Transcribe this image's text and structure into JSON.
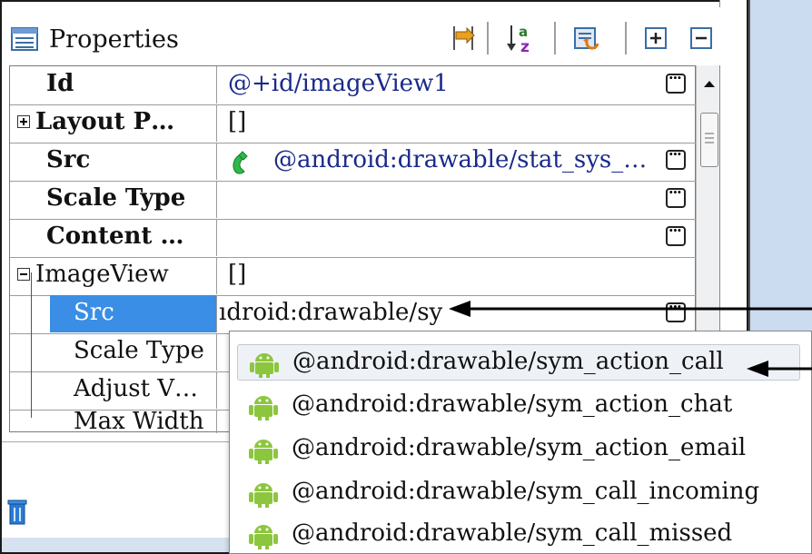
{
  "header": {
    "title": "Properties",
    "toolbar": [
      {
        "name": "show-advanced-icon"
      },
      {
        "name": "sort-alphabetical-icon"
      },
      {
        "name": "restore-default-icon"
      },
      {
        "name": "expand-all-icon"
      },
      {
        "name": "collapse-all-icon"
      }
    ]
  },
  "grid": {
    "rows": [
      {
        "name": "Id",
        "value": "@+id/imageView1"
      },
      {
        "name": "Layout P…",
        "value": "[]"
      },
      {
        "name": "Src",
        "value": "@android:drawable/stat_sys_…"
      },
      {
        "name": "Scale Type",
        "value": ""
      },
      {
        "name": "Content …",
        "value": ""
      },
      {
        "name": "ImageView",
        "value": "[]"
      },
      {
        "name": "Src",
        "value": "ıdroid:drawable/sy"
      },
      {
        "name": "Scale Type",
        "value": ""
      },
      {
        "name": "Adjust V…",
        "value": ""
      },
      {
        "name": "Max Width",
        "value": ""
      }
    ]
  },
  "popup": {
    "items": [
      "@android:drawable/sym_action_call",
      "@android:drawable/sym_action_chat",
      "@android:drawable/sym_action_email",
      "@android:drawable/sym_call_incoming",
      "@android:drawable/sym_call_missed"
    ]
  },
  "colors": {
    "selection": "#3a8ee6",
    "link_text": "#1a2a8a",
    "android_green": "#8cc63f",
    "right_panel": "#ccdcf0"
  }
}
